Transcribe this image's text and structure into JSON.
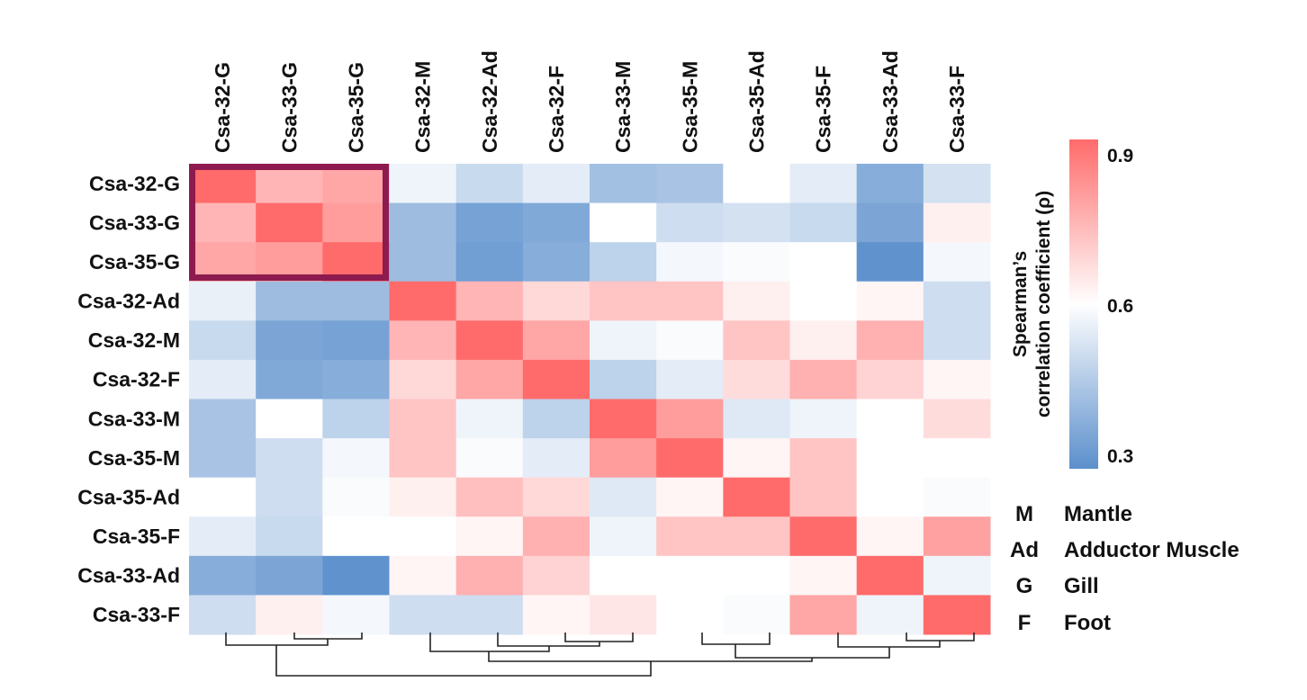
{
  "chart_data": {
    "type": "heatmap",
    "title": "",
    "columns": [
      "Csa-32-G",
      "Csa-33-G",
      "Csa-35-G",
      "Csa-32-M",
      "Csa-32-Ad",
      "Csa-32-F",
      "Csa-33-M",
      "Csa-35-M",
      "Csa-35-Ad",
      "Csa-35-F",
      "Csa-33-Ad",
      "Csa-33-F"
    ],
    "rows": [
      "Csa-32-G",
      "Csa-33-G",
      "Csa-35-G",
      "Csa-32-Ad",
      "Csa-32-M",
      "Csa-32-F",
      "Csa-33-M",
      "Csa-35-M",
      "Csa-35-Ad",
      "Csa-35-F",
      "Csa-33-Ad",
      "Csa-33-F"
    ],
    "values": [
      [
        0.92,
        0.75,
        0.78,
        0.57,
        0.5,
        0.55,
        0.43,
        0.44,
        0.6,
        0.55,
        0.38,
        0.52
      ],
      [
        0.75,
        0.92,
        0.8,
        0.42,
        0.35,
        0.37,
        0.6,
        0.51,
        0.52,
        0.5,
        0.36,
        0.63
      ],
      [
        0.78,
        0.8,
        0.92,
        0.42,
        0.34,
        0.38,
        0.48,
        0.58,
        0.59,
        0.6,
        0.31,
        0.58
      ],
      [
        0.56,
        0.42,
        0.42,
        0.92,
        0.75,
        0.68,
        0.72,
        0.72,
        0.63,
        0.6,
        0.62,
        0.51
      ],
      [
        0.5,
        0.36,
        0.35,
        0.75,
        0.92,
        0.78,
        0.57,
        0.59,
        0.72,
        0.63,
        0.76,
        0.51
      ],
      [
        0.55,
        0.37,
        0.38,
        0.68,
        0.78,
        0.92,
        0.48,
        0.55,
        0.67,
        0.76,
        0.69,
        0.62
      ],
      [
        0.44,
        0.6,
        0.48,
        0.72,
        0.57,
        0.48,
        0.92,
        0.8,
        0.54,
        0.57,
        0.6,
        0.67
      ],
      [
        0.44,
        0.51,
        0.58,
        0.72,
        0.59,
        0.55,
        0.8,
        0.92,
        0.62,
        0.72,
        0.6,
        0.6
      ],
      [
        0.6,
        0.51,
        0.59,
        0.63,
        0.73,
        0.68,
        0.54,
        0.62,
        0.92,
        0.72,
        0.6,
        0.59
      ],
      [
        0.55,
        0.5,
        0.6,
        0.6,
        0.62,
        0.76,
        0.57,
        0.72,
        0.72,
        0.92,
        0.62,
        0.79
      ],
      [
        0.38,
        0.36,
        0.31,
        0.62,
        0.76,
        0.69,
        0.6,
        0.6,
        0.6,
        0.62,
        0.92,
        0.57
      ],
      [
        0.51,
        0.63,
        0.58,
        0.51,
        0.51,
        0.62,
        0.65,
        0.6,
        0.59,
        0.78,
        0.57,
        0.92
      ]
    ],
    "colorbar": {
      "label_line1": "Spearman’s",
      "label_line2": "correlation coefficient (ρ)",
      "range": [
        0.3,
        0.9
      ],
      "ticks": [
        "0.9",
        "0.6",
        "0.3"
      ],
      "colors": {
        "low": "#5b8fcc",
        "mid": "#ffffff",
        "high": "#ff6b6b"
      }
    },
    "highlight": {
      "rows": [
        "Csa-32-G",
        "Csa-33-G",
        "Csa-35-G"
      ],
      "columns": [
        "Csa-32-G",
        "Csa-33-G",
        "Csa-35-G"
      ],
      "color": "#8e1b4f"
    }
  },
  "legend": [
    {
      "abbr": "M",
      "name": "Mantle"
    },
    {
      "abbr": "Ad",
      "name": "Adductor Muscle"
    },
    {
      "abbr": "G",
      "name": "Gill"
    },
    {
      "abbr": "F",
      "name": "Foot"
    }
  ]
}
